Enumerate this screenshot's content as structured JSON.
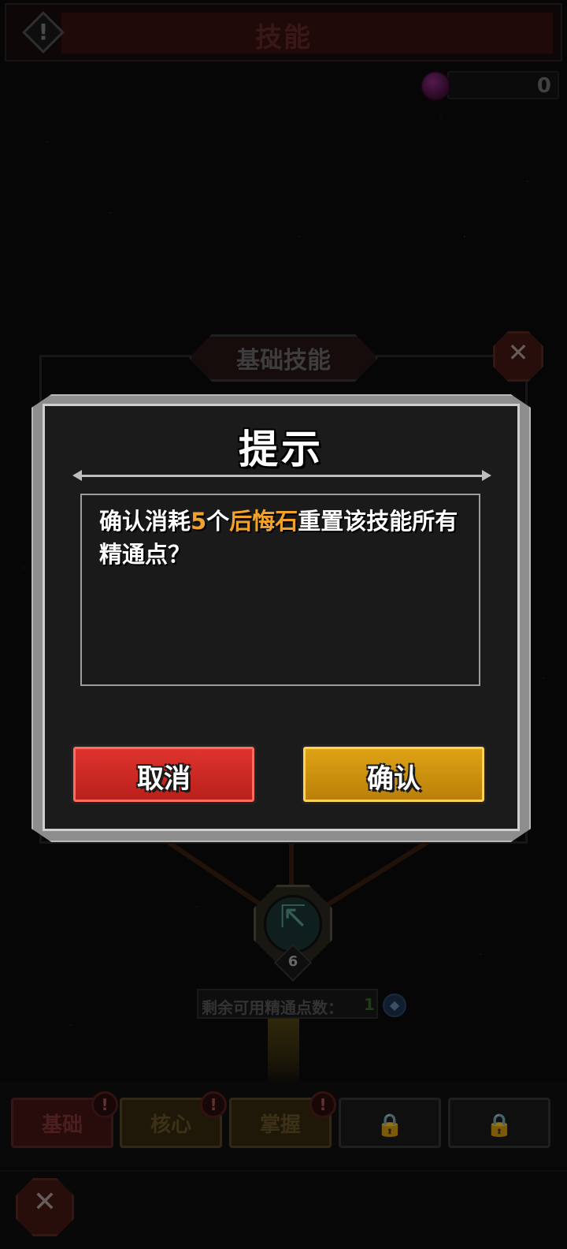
{
  "header": {
    "title": "技能",
    "alert_icon": "warning-icon"
  },
  "currency": {
    "icon": "purple-gem-icon",
    "value": "0"
  },
  "panel": {
    "section_title": "基础技能",
    "reset_icon": "reset-skill-icon",
    "node": {
      "icon": "teal-arrow-icon",
      "level": "6"
    },
    "points_label": "剩余可用精通点数：",
    "points_value": "1",
    "points_icon": "mastery-point-icon"
  },
  "tabs": [
    {
      "label": "基础",
      "active": true,
      "alert": "!"
    },
    {
      "label": "核心",
      "active": false,
      "alert": "!"
    },
    {
      "label": "掌握",
      "active": false,
      "alert": "!"
    },
    {
      "label": "",
      "locked": true,
      "icon": "lock-icon"
    },
    {
      "label": "",
      "locked": true,
      "icon": "lock-icon"
    }
  ],
  "bottom": {
    "badge_icon": "reset-skill-icon"
  },
  "dialog": {
    "title": "提示",
    "message_parts": [
      "确认消耗",
      "5",
      "个",
      "后悔石",
      "重置该技能所有精通点？"
    ],
    "cancel_label": "取消",
    "confirm_label": "确认"
  },
  "colors": {
    "highlight": "#f2a12b",
    "cancel": "#d32a26",
    "confirm": "#d2950f"
  }
}
